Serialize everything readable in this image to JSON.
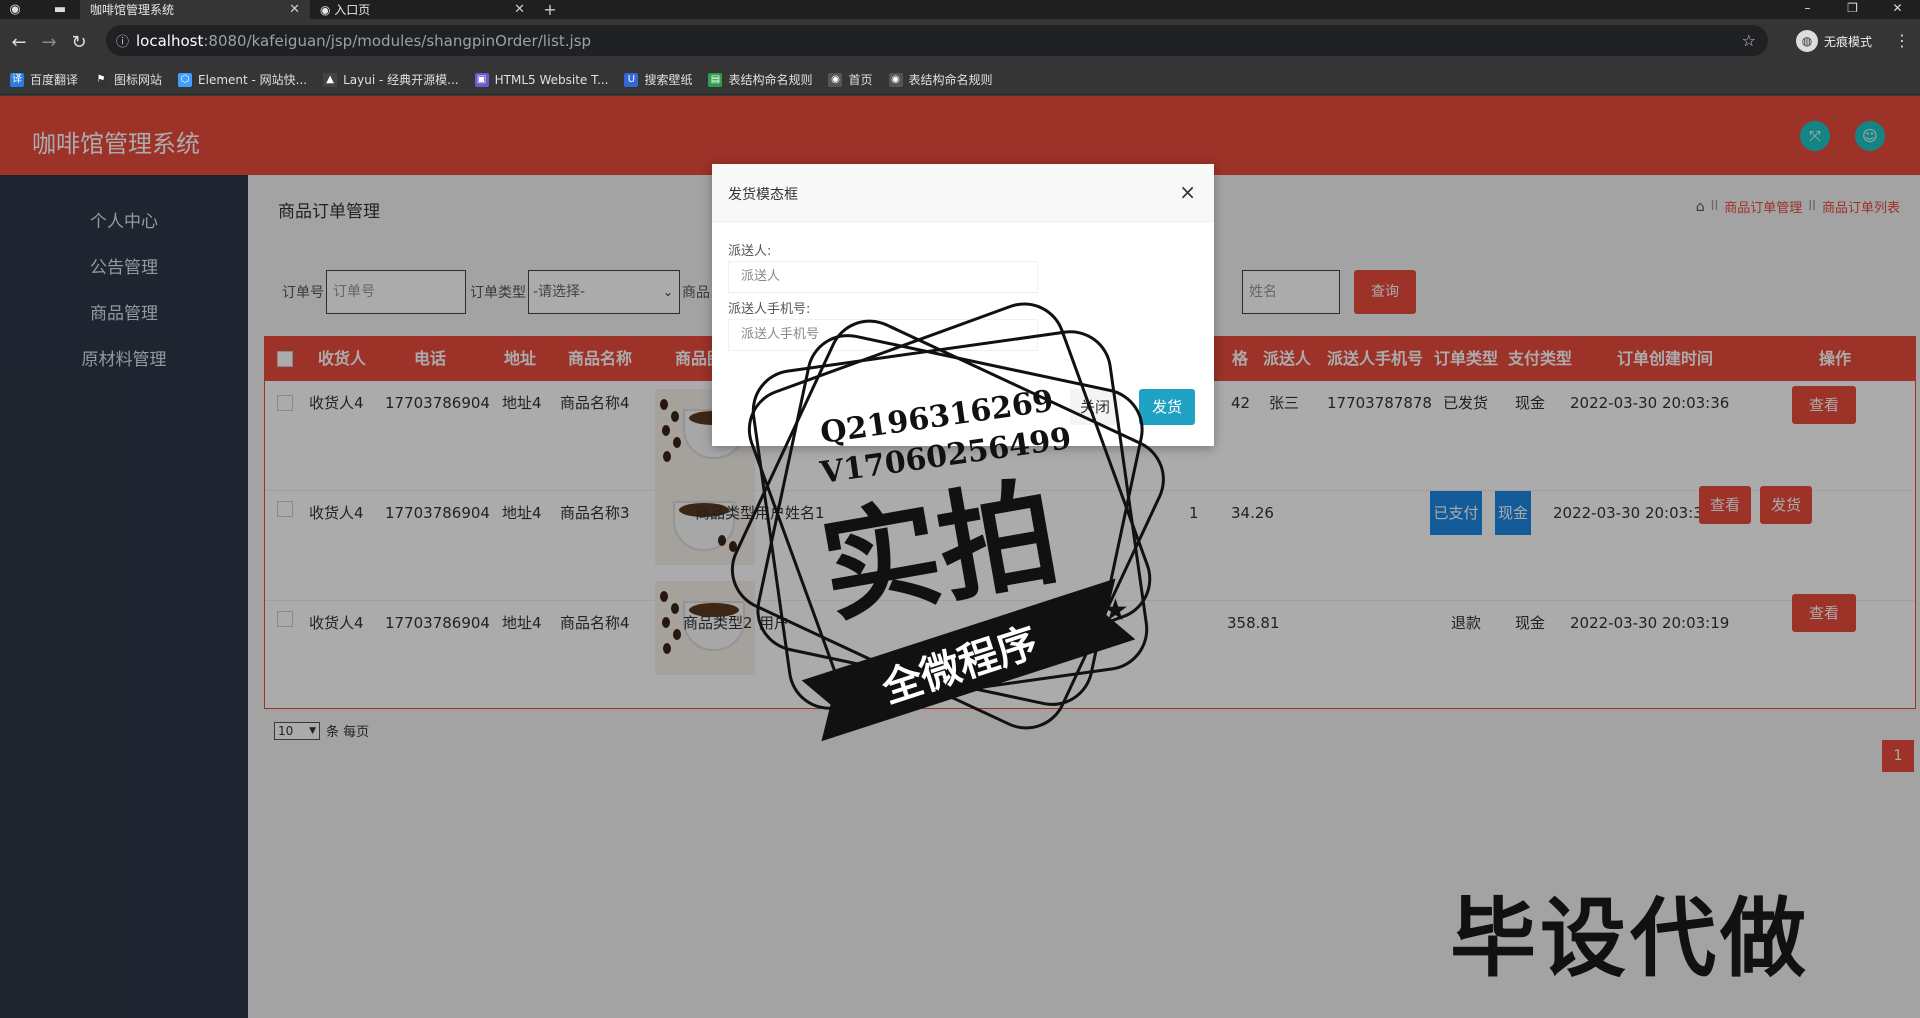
{
  "browser": {
    "tabs": [
      {
        "title": "咖啡馆管理系统",
        "active": true
      },
      {
        "title": "入口页",
        "active": false
      }
    ],
    "url_host": "localhost",
    "url_path": ":8080/kafeiguan/jsp/modules/shangpinOrder/list.jsp",
    "incognito_label": "无痕模式",
    "bookmarks": [
      "百度翻译",
      "图标网站",
      "Element - 网站快...",
      "Layui - 经典开源模...",
      "HTML5 Website T...",
      "搜索壁纸",
      "表结构命名规则",
      "首页",
      "表结构命名规则"
    ]
  },
  "app": {
    "title": "咖啡馆管理系统",
    "sidebar": [
      "个人中心",
      "公告管理",
      "商品管理",
      "原材料管理"
    ],
    "page_title": "商品订单管理",
    "breadcrumb": {
      "level1": "商品订单管理",
      "level2": "商品订单列表",
      "sep": "II"
    },
    "search": {
      "order_no_label": "订单号",
      "order_no_placeholder": "订单号",
      "order_type_label": "订单类型",
      "order_type_value": "-请选择-",
      "product_label": "商品",
      "name_placeholder": "姓名",
      "button": "查询"
    },
    "table": {
      "headers": [
        "收货人",
        "电话",
        "地址",
        "商品名称",
        "商品图片",
        "格",
        "派送人",
        "派送人手机号",
        "订单类型",
        "支付类型",
        "订单创建时间",
        "操作"
      ],
      "rows": [
        {
          "receiver": "收货人4",
          "phone": "17703786904",
          "address": "地址4",
          "product": "商品名称4",
          "price": "42",
          "courier": "张三",
          "courier_phone": "17703787878",
          "order_type": "已发货",
          "pay_type": "现金",
          "created": "2022-03-30 20:03:36",
          "actions": [
            "查看"
          ]
        },
        {
          "receiver": "收货人4",
          "phone": "17703786904",
          "address": "地址4",
          "product": "商品名称3",
          "product_type": "商品类型",
          "user_name": "用户姓名1",
          "qty": "1",
          "price": "34.26",
          "order_type": "已支付",
          "pay_type": "现金",
          "created": "2022-03-30 20:03:36",
          "actions": [
            "查看",
            "发货"
          ]
        },
        {
          "receiver": "收货人4",
          "phone": "17703786904",
          "address": "地址4",
          "product": "商品名称4",
          "product_type": "商品类型2",
          "user_name": "用户",
          "price": "358.81",
          "order_type": "退款",
          "pay_type": "现金",
          "created": "2022-03-30 20:03:19",
          "actions": [
            "查看"
          ]
        }
      ]
    },
    "pager": {
      "page_size": "10",
      "page_size_suffix": "条 每页",
      "current_page": "1"
    }
  },
  "modal": {
    "title": "发货模态框",
    "close_icon": "×",
    "courier_label": "派送人:",
    "courier_placeholder": "派送人",
    "courier_phone_label": "派送人手机号:",
    "courier_phone_placeholder": "派送人手机号",
    "close_button": "关闭",
    "ship_button": "发货"
  },
  "watermark": {
    "contact1": "Q2196316269",
    "contact2": "V17060256499",
    "stamp_main": "实拍",
    "stamp_ribbon": "全微程序",
    "corner_text": "毕设代做"
  },
  "colors": {
    "brand_red": "#e94b3c",
    "sidebar_bg": "#2f3748",
    "accent_teal": "#1fc7c7",
    "badge_blue": "#1e88e5"
  }
}
